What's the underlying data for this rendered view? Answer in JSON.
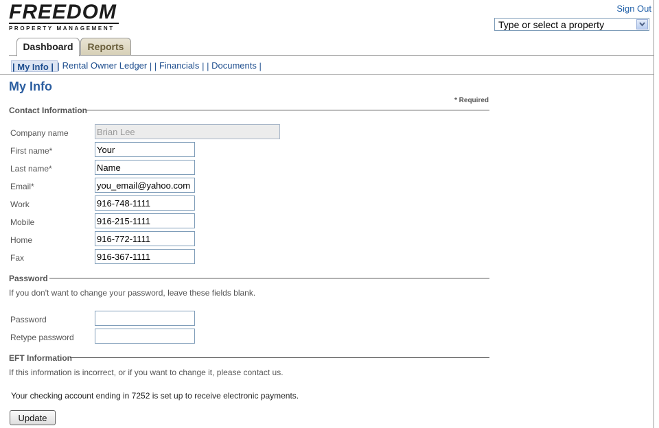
{
  "header": {
    "logo_title": "FREEDOM",
    "logo_subtitle": "PROPERTY MANAGEMENT",
    "sign_out": "Sign Out",
    "property_select": {
      "value": "Type or select a property"
    }
  },
  "tabs": [
    {
      "label": "Dashboard",
      "active": true
    },
    {
      "label": "Reports",
      "active": false
    }
  ],
  "subnav": {
    "items": [
      "My Info",
      "Rental Owner Ledger",
      "Financials",
      "Documents"
    ],
    "separator": "|"
  },
  "page": {
    "title": "My Info",
    "required_note": "* Required"
  },
  "contact": {
    "title": "Contact Information",
    "fields": [
      {
        "label": "Company name",
        "value": "Brian Lee",
        "disabled": true
      },
      {
        "label": "First name*",
        "value": "Your"
      },
      {
        "label": "Last name*",
        "value": "Name"
      },
      {
        "label": "Email*",
        "value": "you_email@yahoo.com"
      },
      {
        "label": "Work",
        "value": "916-748-1111"
      },
      {
        "label": "Mobile",
        "value": "916-215-1111"
      },
      {
        "label": "Home",
        "value": "916-772-1111"
      },
      {
        "label": "Fax",
        "value": "916-367-1111"
      }
    ]
  },
  "password": {
    "title": "Password",
    "note": "If you don't want to change your password, leave these fields blank.",
    "fields": [
      {
        "label": "Password",
        "value": ""
      },
      {
        "label": "Retype password",
        "value": ""
      }
    ]
  },
  "eft": {
    "title": "EFT Information",
    "note": "If this information is incorrect, or if you want to change it, please contact us.",
    "message": "Your checking account ending in 7252 is set up to receive electronic payments."
  },
  "actions": {
    "update": "Update"
  },
  "colors": {
    "link": "#1f5fa8",
    "title": "#2c5ea0",
    "tab_inactive": "#d6cfb6"
  }
}
